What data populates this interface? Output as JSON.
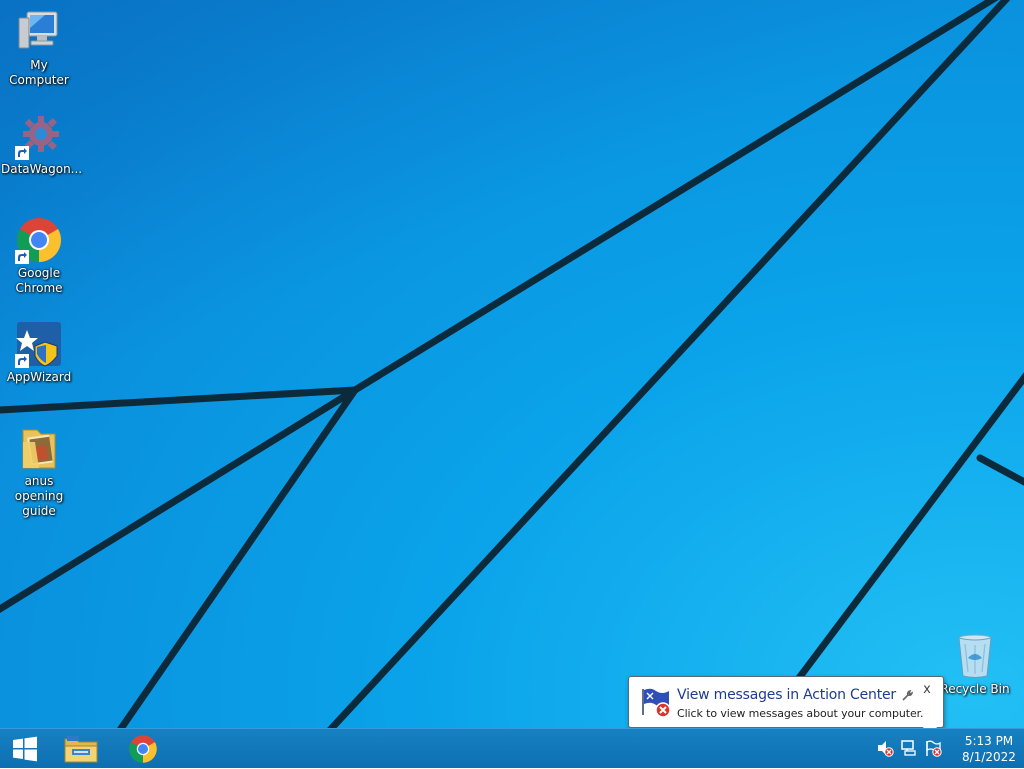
{
  "desktop": {
    "icons": [
      {
        "label": "My Computer",
        "icon": "computer-icon"
      },
      {
        "label": "DataWagon...",
        "icon": "datawagon-gear-icon"
      },
      {
        "label": "Google Chrome",
        "icon": "chrome-icon"
      },
      {
        "label": "AppWizard",
        "icon": "appwizard-icon"
      },
      {
        "label": "anus opening guide",
        "icon": "image-folder-icon"
      },
      {
        "label": "Recycle Bin",
        "icon": "recycle-bin-icon"
      }
    ]
  },
  "taskbar": {
    "start": {
      "icon": "windows-logo-icon"
    },
    "pinned": [
      {
        "icon": "file-explorer-icon"
      },
      {
        "icon": "chrome-icon"
      }
    ],
    "tray": {
      "icons": [
        "volume-muted-icon",
        "network-icon",
        "action-center-flag-icon"
      ],
      "time": "5:13 PM",
      "date": "8/1/2022"
    }
  },
  "notification": {
    "title": "View messages in Action Center",
    "message": "Click to view messages about your computer.",
    "icon": "action-center-flag-icon",
    "close_label": "x"
  },
  "colors": {
    "desktop_blue": "#0a9ae6",
    "taskbar": "#0d6fb1",
    "notification_title": "#1e3c8c"
  }
}
